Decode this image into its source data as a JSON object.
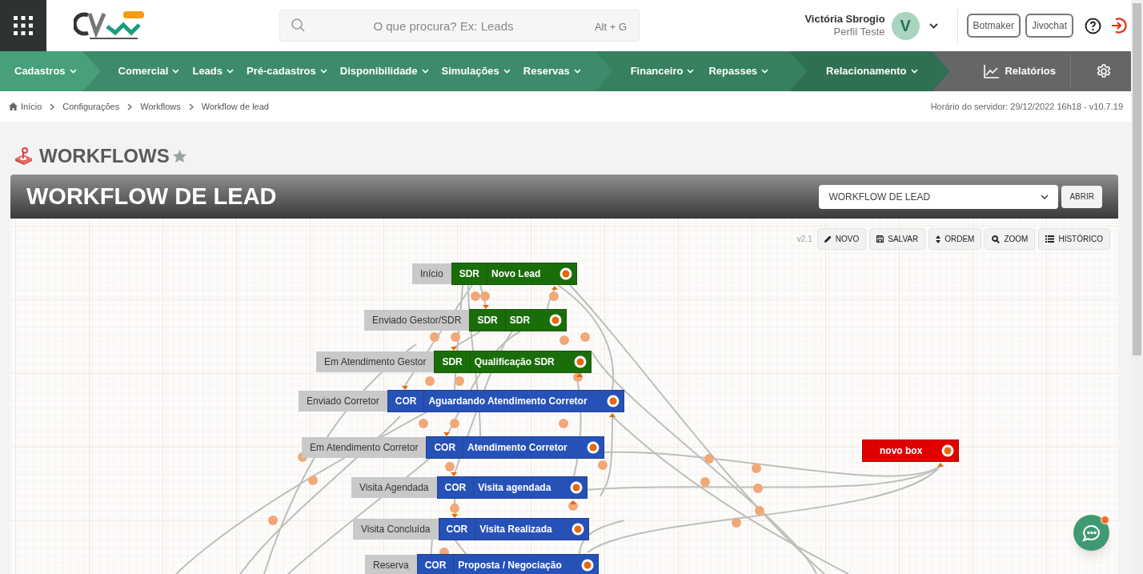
{
  "header": {
    "search": {
      "placeholder": "O que procura? Ex: Leads",
      "shortcut": "Alt + G"
    },
    "user": {
      "name": "Victória Sbrogio",
      "profile": "Perfil Teste",
      "initial": "V"
    },
    "buttons": [
      "Botmaker",
      "Jivochat"
    ]
  },
  "nav": {
    "groups": [
      {
        "items": [
          "Cadastros"
        ]
      },
      {
        "items": [
          "Comercial",
          "Leads",
          "Pré-cadastros",
          "Disponibilidade",
          "Simulações",
          "Reservas"
        ]
      },
      {
        "items": [
          "Financeiro",
          "Repasses"
        ]
      },
      {
        "items": [
          "Relacionamento"
        ]
      }
    ],
    "reports": "Relatórios"
  },
  "breadcrumb": [
    "Início",
    "Configurações",
    "Workflows",
    "Workflow de lead"
  ],
  "server_time": "Horário do servidor: 29/12/2022 16h18 - v10.7.19",
  "page_title": "WORKFLOWS",
  "panel": {
    "title": "WORKFLOW DE LEAD",
    "select_value": "WORKFLOW DE LEAD",
    "open_button": "ABRIR",
    "version": "v2.1",
    "toolbar": [
      {
        "label": "NOVO",
        "kind": "pencil"
      },
      {
        "label": "SALVAR",
        "kind": "save"
      },
      {
        "label": "ORDEM",
        "kind": "sort"
      },
      {
        "label": "ZOOM",
        "kind": "search"
      },
      {
        "label": "HISTÓRICO",
        "kind": "list"
      }
    ]
  },
  "workflow_nodes": [
    {
      "label": "Início",
      "role": "SDR",
      "name": "Novo Lead",
      "color": "#1a6e0a"
    },
    {
      "label": "Enviado Gestor/SDR",
      "role": "SDR",
      "name": "SDR",
      "color": "#1a6e0a"
    },
    {
      "label": "Em Atendimento Gestor",
      "role": "SDR",
      "name": "Qualificação SDR",
      "color": "#1a6e0a"
    },
    {
      "label": "Enviado Corretor",
      "role": "COR",
      "name": "Aguardando Atendimento Corretor",
      "color": "#2652b8"
    },
    {
      "label": "Em Atendimento Corretor",
      "role": "COR",
      "name": "Atendimento Corretor",
      "color": "#2652b8"
    },
    {
      "label": "Visita Agendada",
      "role": "COR",
      "name": "Visita agendada",
      "color": "#2652b8"
    },
    {
      "label": "Visita Concluída",
      "role": "COR",
      "name": "Visita Realizada",
      "color": "#2652b8"
    },
    {
      "label": "Reserva",
      "role": "COR",
      "name": "Proposta / Negociação",
      "color": "#2652b8"
    },
    {
      "name": "novo box",
      "color": "#e00000"
    }
  ]
}
